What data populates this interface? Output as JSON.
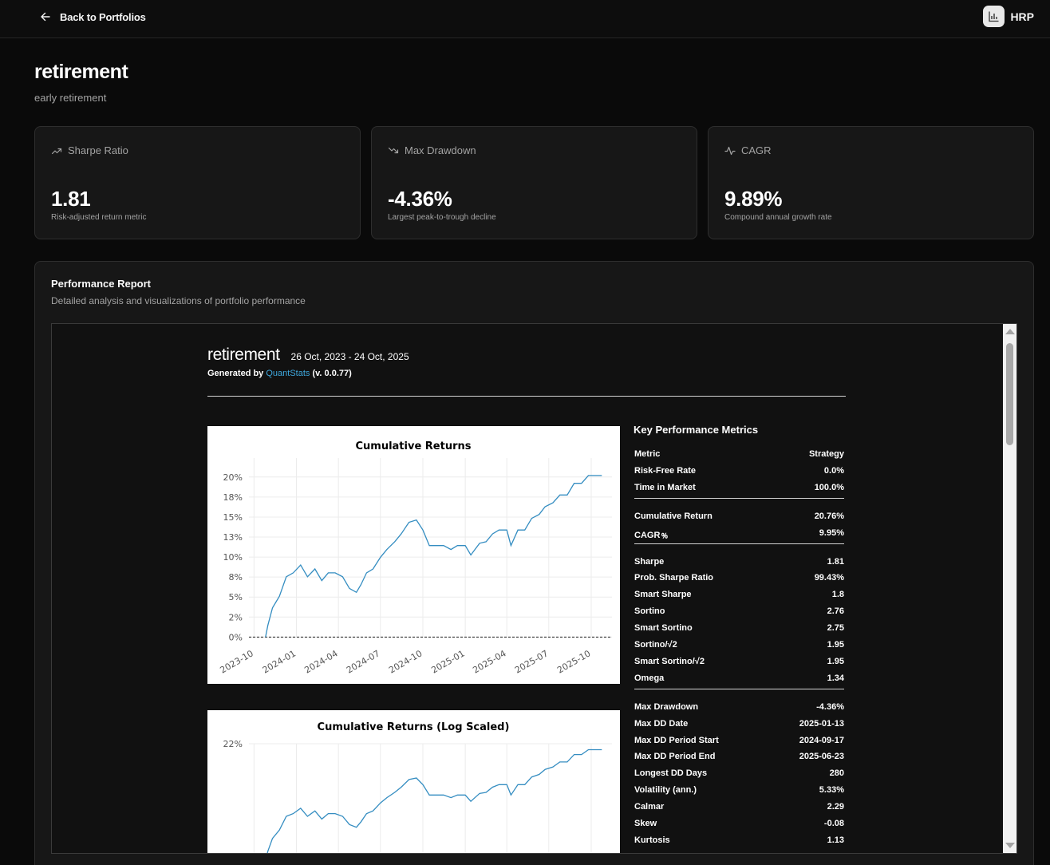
{
  "nav": {
    "back_label": "Back to Portfolios",
    "brand": "HRP"
  },
  "page": {
    "title": "retirement",
    "subtitle": "early retirement"
  },
  "cards": [
    {
      "icon": "trending-up-icon",
      "label": "Sharpe Ratio",
      "value": "1.81",
      "desc": "Risk-adjusted return metric"
    },
    {
      "icon": "trending-down-icon",
      "label": "Max Drawdown",
      "value": "-4.36%",
      "desc": "Largest peak-to-trough decline"
    },
    {
      "icon": "activity-icon",
      "label": "CAGR",
      "value": "9.89%",
      "desc": "Compound annual growth rate"
    }
  ],
  "report": {
    "title": "Performance Report",
    "description": "Detailed analysis and visualizations of portfolio performance",
    "name": "retirement",
    "dates": "26 Oct, 2023 - 24 Oct, 2025",
    "generated_prefix": "Generated by ",
    "generated_link": "QuantStats",
    "generated_suffix": " (v. 0.0.77)",
    "metrics_title": "Key Performance Metrics",
    "metrics_header": {
      "metric": "Metric",
      "strategy": "Strategy"
    },
    "metrics_groups": [
      [
        [
          "Risk-Free Rate",
          "0.0%"
        ],
        [
          "Time in Market",
          "100.0%"
        ]
      ],
      [
        [
          "Cumulative Return",
          "20.76%"
        ],
        [
          "CAGR﹪",
          "9.95%"
        ]
      ],
      [
        [
          "Sharpe",
          "1.81"
        ],
        [
          "Prob. Sharpe Ratio",
          "99.43%"
        ],
        [
          "Smart Sharpe",
          "1.8"
        ],
        [
          "Sortino",
          "2.76"
        ],
        [
          "Smart Sortino",
          "2.75"
        ],
        [
          "Sortino/√2",
          "1.95"
        ],
        [
          "Smart Sortino/√2",
          "1.95"
        ],
        [
          "Omega",
          "1.34"
        ]
      ],
      [
        [
          "Max Drawdown",
          "-4.36%"
        ],
        [
          "Max DD Date",
          "2025-01-13"
        ],
        [
          "Max DD Period Start",
          "2024-09-17"
        ],
        [
          "Max DD Period End",
          "2025-06-23"
        ],
        [
          "Longest DD Days",
          "280"
        ],
        [
          "Volatility (ann.)",
          "5.33%"
        ],
        [
          "Calmar",
          "2.29"
        ],
        [
          "Skew",
          "-0.08"
        ],
        [
          "Kurtosis",
          "1.13"
        ]
      ]
    ]
  },
  "chart_data": [
    {
      "type": "line",
      "title": "Cumulative Returns",
      "xlabel": "",
      "ylabel": "",
      "x_ticks": [
        "2023-10",
        "2024-01",
        "2024-04",
        "2024-07",
        "2024-10",
        "2025-01",
        "2025-04",
        "2025-07",
        "2025-10"
      ],
      "y_ticks": [
        "0%",
        "2%",
        "5%",
        "8%",
        "10%",
        "13%",
        "15%",
        "18%",
        "20%"
      ],
      "ylim": [
        -1.5,
        23
      ],
      "grid": true,
      "color": "#348dc1",
      "x": [
        "2023-10-26",
        "2023-10-31",
        "2023-11-10",
        "2023-11-25",
        "2023-12-10",
        "2023-12-25",
        "2024-01-10",
        "2024-01-25",
        "2024-02-10",
        "2024-02-25",
        "2024-03-10",
        "2024-03-25",
        "2024-04-10",
        "2024-04-25",
        "2024-05-10",
        "2024-05-20",
        "2024-06-01",
        "2024-06-15",
        "2024-07-01",
        "2024-07-15",
        "2024-08-01",
        "2024-08-15",
        "2024-09-01",
        "2024-09-17",
        "2024-10-01",
        "2024-10-15",
        "2024-11-01",
        "2024-11-15",
        "2024-12-01",
        "2024-12-15",
        "2025-01-01",
        "2025-01-13",
        "2025-02-01",
        "2025-02-15",
        "2025-03-01",
        "2025-03-15",
        "2025-04-01",
        "2025-04-10",
        "2025-04-25",
        "2025-05-10",
        "2025-05-25",
        "2025-06-10",
        "2025-06-23",
        "2025-07-10",
        "2025-07-25",
        "2025-08-10",
        "2025-08-25",
        "2025-09-10",
        "2025-09-25",
        "2025-10-10",
        "2025-10-24"
      ],
      "values": [
        0.0,
        1.5,
        3.5,
        5.5,
        7.5,
        8.5,
        9.0,
        8.0,
        8.5,
        7.5,
        8.0,
        8.5,
        7.5,
        6.5,
        5.5,
        7.0,
        8.0,
        9.0,
        10.0,
        11.5,
        12.0,
        13.5,
        14.5,
        15.3,
        13.5,
        12.0,
        11.5,
        12.0,
        11.0,
        12.0,
        11.5,
        10.8,
        11.8,
        12.5,
        13.0,
        14.0,
        13.5,
        12.0,
        13.5,
        14.0,
        15.0,
        16.0,
        16.5,
        17.5,
        18.0,
        18.5,
        19.5,
        20.0,
        20.5,
        21.0,
        20.76
      ]
    },
    {
      "type": "line",
      "title": "Cumulative Returns (Log Scaled)",
      "xlabel": "",
      "ylabel": "",
      "log_scale": true,
      "y_ticks": [
        "22%"
      ],
      "grid": true,
      "color": "#348dc1",
      "x": [
        "2023-10-26",
        "2023-10-31",
        "2023-11-10",
        "2023-11-25",
        "2023-12-10",
        "2023-12-25",
        "2024-01-10",
        "2024-01-25",
        "2024-02-10",
        "2024-02-25",
        "2024-03-10",
        "2024-03-25",
        "2024-04-10",
        "2024-04-25",
        "2024-05-10",
        "2024-05-20",
        "2024-06-01",
        "2024-06-15",
        "2024-07-01",
        "2024-07-15",
        "2024-08-01",
        "2024-08-15",
        "2024-09-01",
        "2024-09-17",
        "2024-10-01",
        "2024-10-15",
        "2024-11-01",
        "2024-11-15",
        "2024-12-01",
        "2024-12-15",
        "2025-01-01",
        "2025-01-13",
        "2025-02-01",
        "2025-02-15",
        "2025-03-01",
        "2025-03-15",
        "2025-04-01",
        "2025-04-10",
        "2025-04-25",
        "2025-05-10",
        "2025-05-25",
        "2025-06-10",
        "2025-06-23",
        "2025-07-10",
        "2025-07-25",
        "2025-08-10",
        "2025-08-25",
        "2025-09-10",
        "2025-09-25",
        "2025-10-10",
        "2025-10-24"
      ],
      "values": [
        0.0,
        1.5,
        3.5,
        5.5,
        7.5,
        8.5,
        9.0,
        8.0,
        8.5,
        7.5,
        8.0,
        8.5,
        7.5,
        6.5,
        5.5,
        7.0,
        8.0,
        9.0,
        10.0,
        11.5,
        12.0,
        13.5,
        14.5,
        15.3,
        13.5,
        12.0,
        11.5,
        12.0,
        11.0,
        12.0,
        11.5,
        10.8,
        11.8,
        12.5,
        13.0,
        14.0,
        13.5,
        12.0,
        13.5,
        14.0,
        15.0,
        16.0,
        16.5,
        17.5,
        18.0,
        18.5,
        19.5,
        20.0,
        20.5,
        21.0,
        20.76
      ]
    }
  ]
}
